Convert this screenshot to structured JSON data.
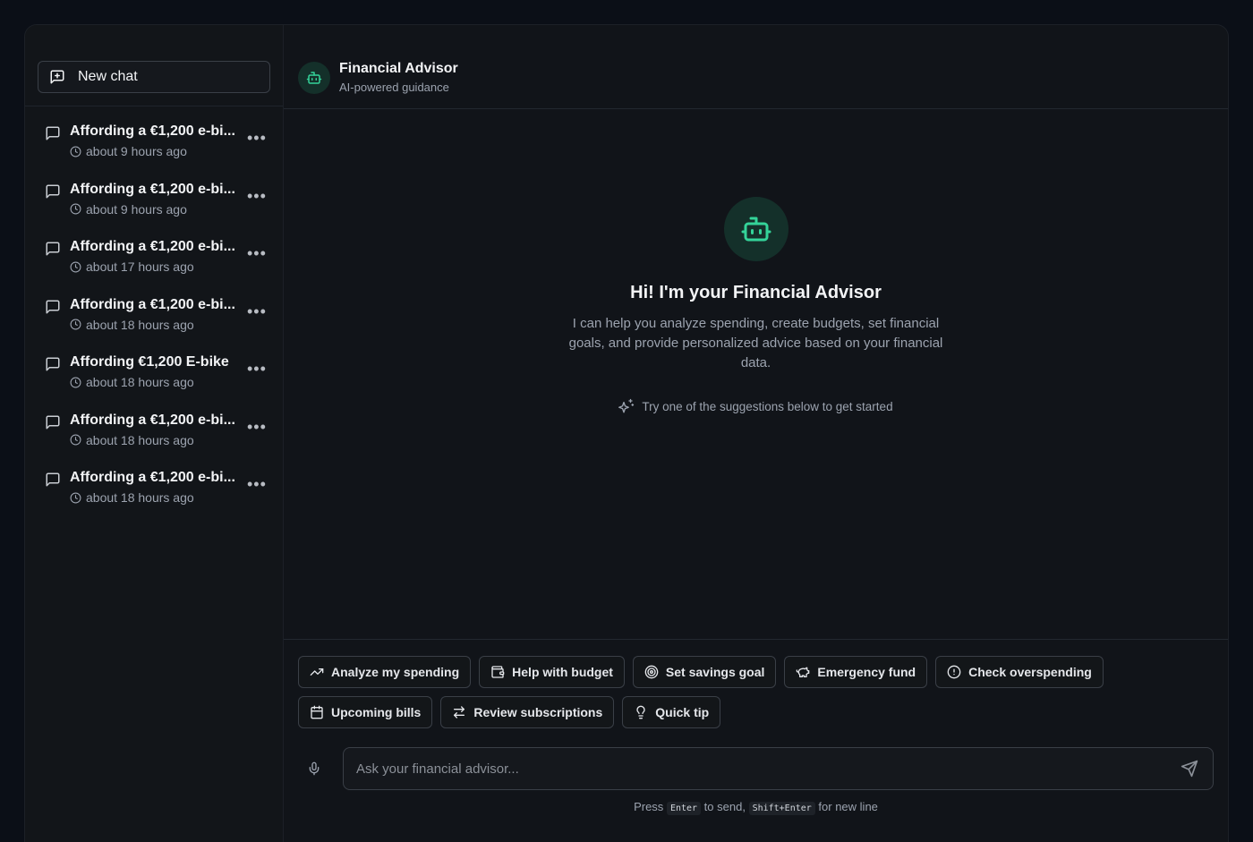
{
  "sidebar": {
    "new_chat_label": "New chat",
    "items": [
      {
        "title": "Affording a €1,200 e-bi...",
        "time": "about 9 hours ago"
      },
      {
        "title": "Affording a €1,200 e-bi...",
        "time": "about 9 hours ago"
      },
      {
        "title": "Affording a €1,200 e-bi...",
        "time": "about 17 hours ago"
      },
      {
        "title": "Affording a €1,200 e-bi...",
        "time": "about 18 hours ago"
      },
      {
        "title": "Affording €1,200 E-bike",
        "time": "about 18 hours ago"
      },
      {
        "title": "Affording a €1,200 e-bi...",
        "time": "about 18 hours ago"
      },
      {
        "title": "Affording a €1,200 e-bi...",
        "time": "about 18 hours ago"
      }
    ],
    "more_glyph": "•••"
  },
  "header": {
    "title": "Financial Advisor",
    "subtitle": "AI-powered guidance"
  },
  "welcome": {
    "heading": "Hi! I'm your Financial Advisor",
    "body": "I can help you analyze spending, create budgets, set financial goals, and provide personalized advice based on your financial data.",
    "hint": "Try one of the suggestions below to get started"
  },
  "suggestions": [
    {
      "label": "Analyze my spending",
      "icon": "trending-up-icon"
    },
    {
      "label": "Help with budget",
      "icon": "wallet-icon"
    },
    {
      "label": "Set savings goal",
      "icon": "target-icon"
    },
    {
      "label": "Emergency fund",
      "icon": "piggy-bank-icon"
    },
    {
      "label": "Check overspending",
      "icon": "alert-circle-icon"
    },
    {
      "label": "Upcoming bills",
      "icon": "calendar-icon"
    },
    {
      "label": "Review subscriptions",
      "icon": "repeat-icon"
    },
    {
      "label": "Quick tip",
      "icon": "lightbulb-icon"
    }
  ],
  "composer": {
    "placeholder": "Ask your financial advisor...",
    "hint_press": "Press",
    "hint_enter_key": "Enter",
    "hint_to_send": "to send,",
    "hint_shift_key": "Shift+Enter",
    "hint_newline": "for new line"
  },
  "colors": {
    "accent": "#34d399",
    "background": "#111419",
    "border": "#3a3f47"
  }
}
